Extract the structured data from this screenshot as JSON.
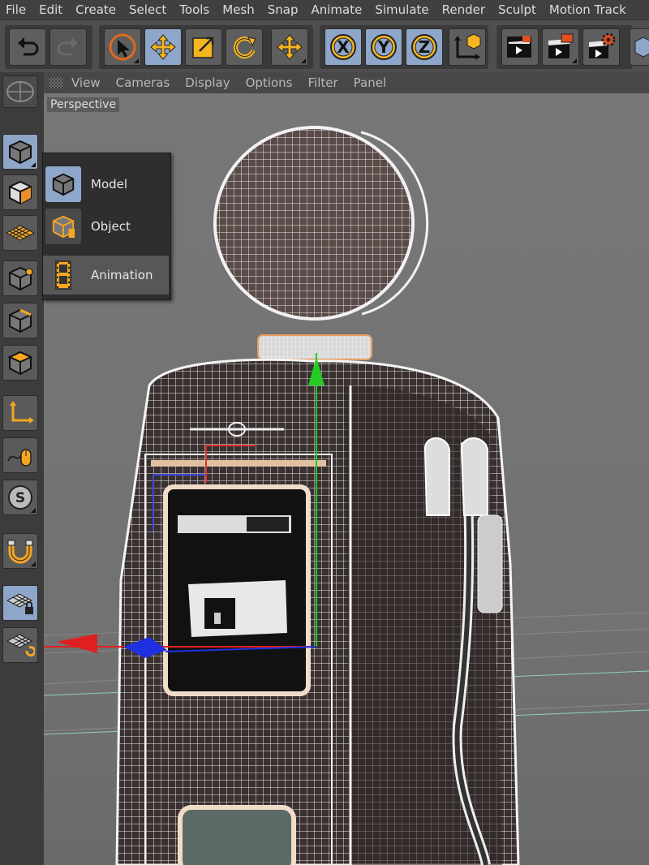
{
  "menubar": {
    "items": [
      "File",
      "Edit",
      "Create",
      "Select",
      "Tools",
      "Mesh",
      "Snap",
      "Animate",
      "Simulate",
      "Render",
      "Sculpt",
      "Motion Track"
    ]
  },
  "toolbar": {
    "axis_x": "X",
    "axis_y": "Y",
    "axis_z": "Z",
    "icons": [
      "undo-icon",
      "redo-icon",
      "live-selection-icon",
      "move-icon",
      "scale-icon",
      "rotate-icon",
      "recent-tool-icon",
      "x-axis-lock-icon",
      "y-axis-lock-icon",
      "z-axis-lock-icon",
      "coordinate-system-icon",
      "render-view-icon",
      "render-to-picture-viewer-icon",
      "render-settings-icon"
    ]
  },
  "leftbar": {
    "icons": [
      "viewport-solo-icon",
      "model-mode-icon",
      "texture-mode-icon",
      "workplane-icon",
      "points-mode-icon",
      "edges-mode-icon",
      "polygons-mode-icon",
      "axis-mode-icon",
      "tweak-mode-icon",
      "solo-mode-icon",
      "snapping-icon",
      "workplane-lock-icon",
      "workplane-align-icon"
    ]
  },
  "viewport": {
    "menu": [
      "View",
      "Cameras",
      "Display",
      "Options",
      "Filter",
      "Panel"
    ],
    "camera_label": "Perspective"
  },
  "popup": {
    "items": [
      {
        "label": "Model",
        "icon": "model-cube-icon"
      },
      {
        "label": "Object",
        "icon": "object-cube-icon"
      },
      {
        "label": "Animation",
        "icon": "film-strip-icon"
      }
    ]
  },
  "colors": {
    "accent_orange": "#f5a623",
    "active_blue": "#8ea6c9",
    "axis_x": "#e02020",
    "axis_y": "#22cc22",
    "axis_z": "#2030e0"
  }
}
